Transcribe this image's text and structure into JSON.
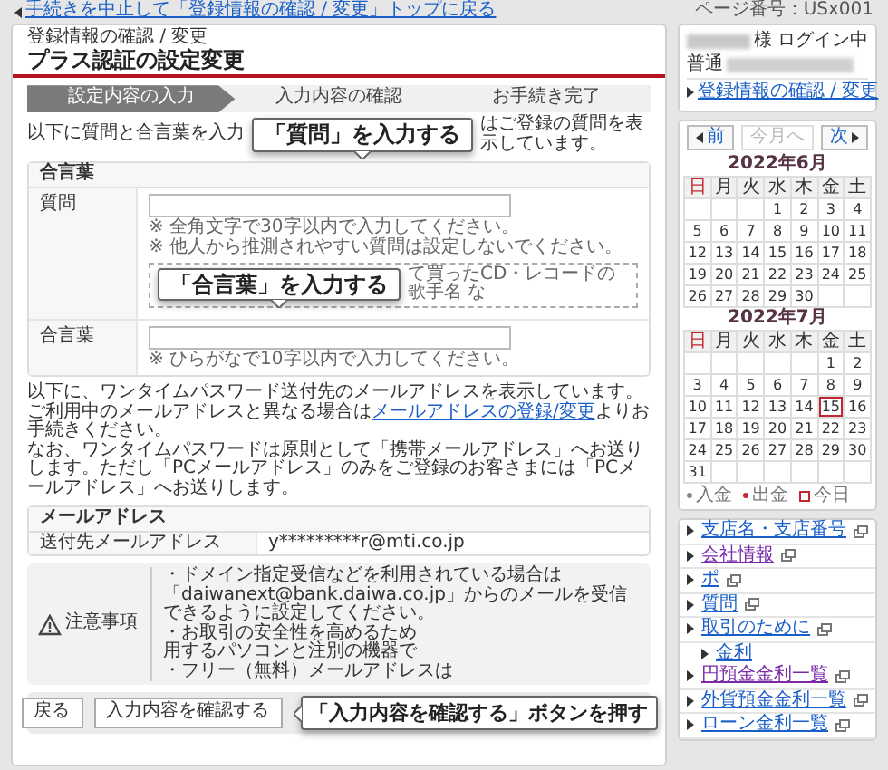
{
  "top_link": "手続きを中止して「登録情報の確認 / 変更」トップに戻る",
  "page_number": "ページ番号：USx001",
  "breadcrumb": "登録情報の確認 / 変更",
  "title": "プラス認証の設定変更",
  "steps": [
    {
      "label": "設定内容の入力",
      "selected": true
    },
    {
      "label": "入力内容の確認",
      "selected": false
    },
    {
      "label": "お手続き完了",
      "selected": false
    }
  ],
  "intro": [
    "以下に質問と合言葉を入力",
    "はご登録の質問を表示しています。"
  ],
  "callouts": [
    "「質問」を入力する",
    "「合言葉」を入力する",
    "「入力内容を確認する」ボタンを押す"
  ],
  "passphrase_section": {
    "heading": "合言葉",
    "rows": [
      {
        "label": "質問",
        "notes": [
          "※ 全角文字で30字以内で入力してください。",
          "※ 他人から推測されやすい質問は設定しないでください。"
        ],
        "example_fragment": "て買ったCD・レコードの歌手名 な"
      },
      {
        "label": "合言葉",
        "notes": [
          "※ ひらがなで10字以内で入力してください。"
        ]
      }
    ]
  },
  "email_notice": {
    "before_link": "以下に、ワンタイムパスワード送付先のメールアドレスを表示しています。ご利用中のメールアドレスと異なる場合は",
    "link": "メールアドレスの登録/変更",
    "after_link": "よりお手続きください。",
    "note": "なお、ワンタイムパスワードは原則として「携帯メールアドレス」へお送りします。ただし「PCメールアドレス」のみをご登録のお客さまには「PCメールアドレス」へお送りします。"
  },
  "email_section": {
    "heading": "メールアドレス",
    "label": "送付先メールアドレス",
    "value": "y*********r@mti.co.jp"
  },
  "caution": {
    "heading": "注意事項",
    "lines": [
      "・ドメイン指定受信などを利用されている場合は「daiwanext@bank.daiwa.co.jp」からのメールを受信できるように設定してください。",
      "・お取引の安全性を高めるため",
      "用するパソコンと注別の機器で",
      "・フリー（無料）メールアドレスは"
    ]
  },
  "buttons": [
    {
      "label": "戻る"
    },
    {
      "label": "入力内容を確認する"
    }
  ],
  "sidebar": {
    "login_suffix": "様 ログイン中",
    "account_type": "普通",
    "link": "登録情報の確認 / 変更",
    "calendar": {
      "nav": [
        {
          "label": "前",
          "kind": "prev",
          "disabled": false
        },
        {
          "label": "今月へ",
          "kind": "current",
          "disabled": true
        },
        {
          "label": "次",
          "kind": "next",
          "disabled": false
        }
      ],
      "months": [
        {
          "title": "2022年6月",
          "weekdays": [
            "日",
            "月",
            "火",
            "水",
            "木",
            "金",
            "土"
          ],
          "weeks": [
            [
              "1",
              "2",
              "3",
              "4"
            ],
            [
              "5",
              "6",
              "7",
              "8",
              "9",
              "10",
              "11"
            ],
            [
              "12",
              "13",
              "14",
              "15",
              "16",
              "17",
              "18"
            ],
            [
              "19",
              "20",
              "21",
              "22",
              "23",
              "24",
              "25"
            ],
            [
              "26",
              "27",
              "28",
              "29",
              "30"
            ]
          ]
        },
        {
          "title": "2022年7月",
          "weekdays": [
            "日",
            "月",
            "火",
            "水",
            "木",
            "金",
            "土"
          ],
          "weeks": [
            [
              "1",
              "2"
            ],
            [
              "3",
              "4",
              "5",
              "6",
              "7",
              "8",
              "9"
            ],
            [
              "10",
              "11",
              "12",
              "13",
              "14",
              {
                "day": "15",
                "today": true
              },
              "16"
            ],
            [
              "17",
              "18",
              "19",
              "20",
              "21",
              "22",
              "23"
            ],
            [
              "24",
              "25",
              "26",
              "27",
              "28",
              "29",
              "30"
            ],
            [
              "31"
            ]
          ]
        }
      ],
      "legend": [
        {
          "label": "入金",
          "kind": "deposit"
        },
        {
          "label": "出金",
          "kind": "withdrawal"
        },
        {
          "label": "今日",
          "kind": "today"
        }
      ]
    },
    "links": [
      {
        "label": "支店名・支店番号",
        "external": true,
        "visited": false
      },
      {
        "label": "会社情報",
        "external": true,
        "visited": true
      },
      {
        "label": "ポ",
        "external": true,
        "visited": false
      },
      {
        "label": "質問",
        "external": true,
        "visited": false
      },
      {
        "label": "取引のために",
        "external": true,
        "visited": false,
        "children": [
          {
            "label": "金利",
            "external": false,
            "visited": false
          }
        ]
      },
      {
        "label": "円預金金利一覧",
        "external": true,
        "visited": true
      },
      {
        "label": "外貨預金金利一覧",
        "external": true,
        "visited": false
      },
      {
        "label": "ローン金利一覧",
        "external": true,
        "visited": false
      }
    ]
  }
}
